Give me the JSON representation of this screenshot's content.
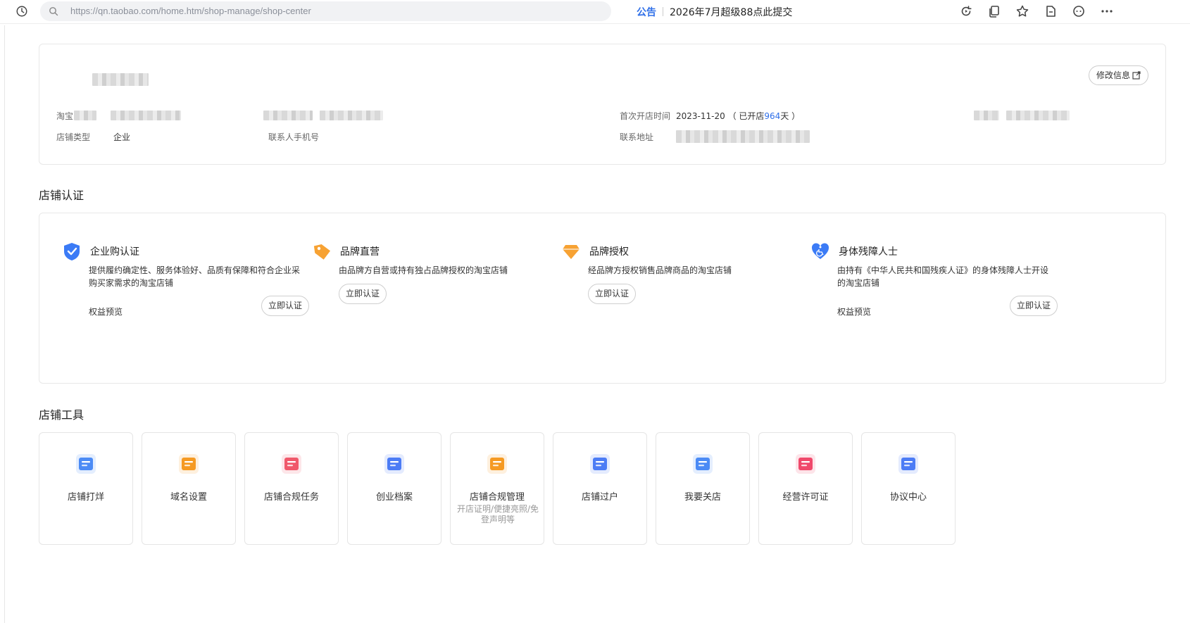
{
  "browser": {
    "url": "https://qn.taobao.com/home.htm/shop-manage/shop-center",
    "notice_tag": "公告",
    "notice_text": "2026年7月超级88点此提交"
  },
  "shop_info": {
    "edit_button": "修改信息",
    "label_taobao": "淘宝",
    "label_first_open": "首次开店时间",
    "first_open_date": "2023-11-20",
    "open_prefix": "（ 已开店",
    "open_days": "964",
    "open_suffix": "天 ）",
    "label_shop_type": "店铺类型",
    "shop_type": "企业",
    "label_contact_phone": "联系人手机号",
    "label_contact_address": "联系地址"
  },
  "certification": {
    "title": "店铺认证",
    "items": [
      {
        "name": "企业购认证",
        "desc": "提供履约确定性、服务体验好、品质有保障和符合企业采购买家需求的淘宝店铺",
        "preview": "权益预览",
        "button": "立即认证",
        "icon": "shield-check-icon",
        "color": "#3b7bf6"
      },
      {
        "name": "品牌直营",
        "desc": "由品牌方自营或持有独占品牌授权的淘宝店铺",
        "preview": "",
        "button": "立即认证",
        "icon": "tag-icon",
        "color": "#f7a233"
      },
      {
        "name": "品牌授权",
        "desc": "经品牌方授权销售品牌商品的淘宝店铺",
        "preview": "",
        "button": "立即认证",
        "icon": "diamond-icon",
        "color": "#f7a233"
      },
      {
        "name": "身体残障人士",
        "desc": "由持有《中华人民共和国残疾人证》的身体残障人士开设的淘宝店铺",
        "preview": "权益预览",
        "button": "立即认证",
        "icon": "heart-accessibility-icon",
        "color": "#3b7bf6"
      }
    ]
  },
  "tools": {
    "title": "店铺工具",
    "items": [
      {
        "name": "店铺打烊",
        "sub": "",
        "icon": "shop-close-icon",
        "color": "#4c8bf5"
      },
      {
        "name": "域名设置",
        "sub": "",
        "icon": "domain-icon",
        "color": "#f59a23"
      },
      {
        "name": "店铺合规任务",
        "sub": "",
        "icon": "compliance-shield-icon",
        "color": "#f0596b"
      },
      {
        "name": "创业档案",
        "sub": "",
        "icon": "archive-icon",
        "color": "#4c7cf5"
      },
      {
        "name": "店铺合规管理",
        "sub": "开店证明/便捷亮照/免登声明等",
        "icon": "document-lock-icon",
        "color": "#f59a23"
      },
      {
        "name": "店铺过户",
        "sub": "",
        "icon": "transfer-icon",
        "color": "#4c7cf5"
      },
      {
        "name": "我要关店",
        "sub": "",
        "icon": "card-icon",
        "color": "#4c8bf5"
      },
      {
        "name": "经营许可证",
        "sub": "",
        "icon": "license-icon",
        "color": "#f0496b"
      },
      {
        "name": "协议中心",
        "sub": "",
        "icon": "agreement-icon",
        "color": "#4c7cf5"
      }
    ]
  }
}
